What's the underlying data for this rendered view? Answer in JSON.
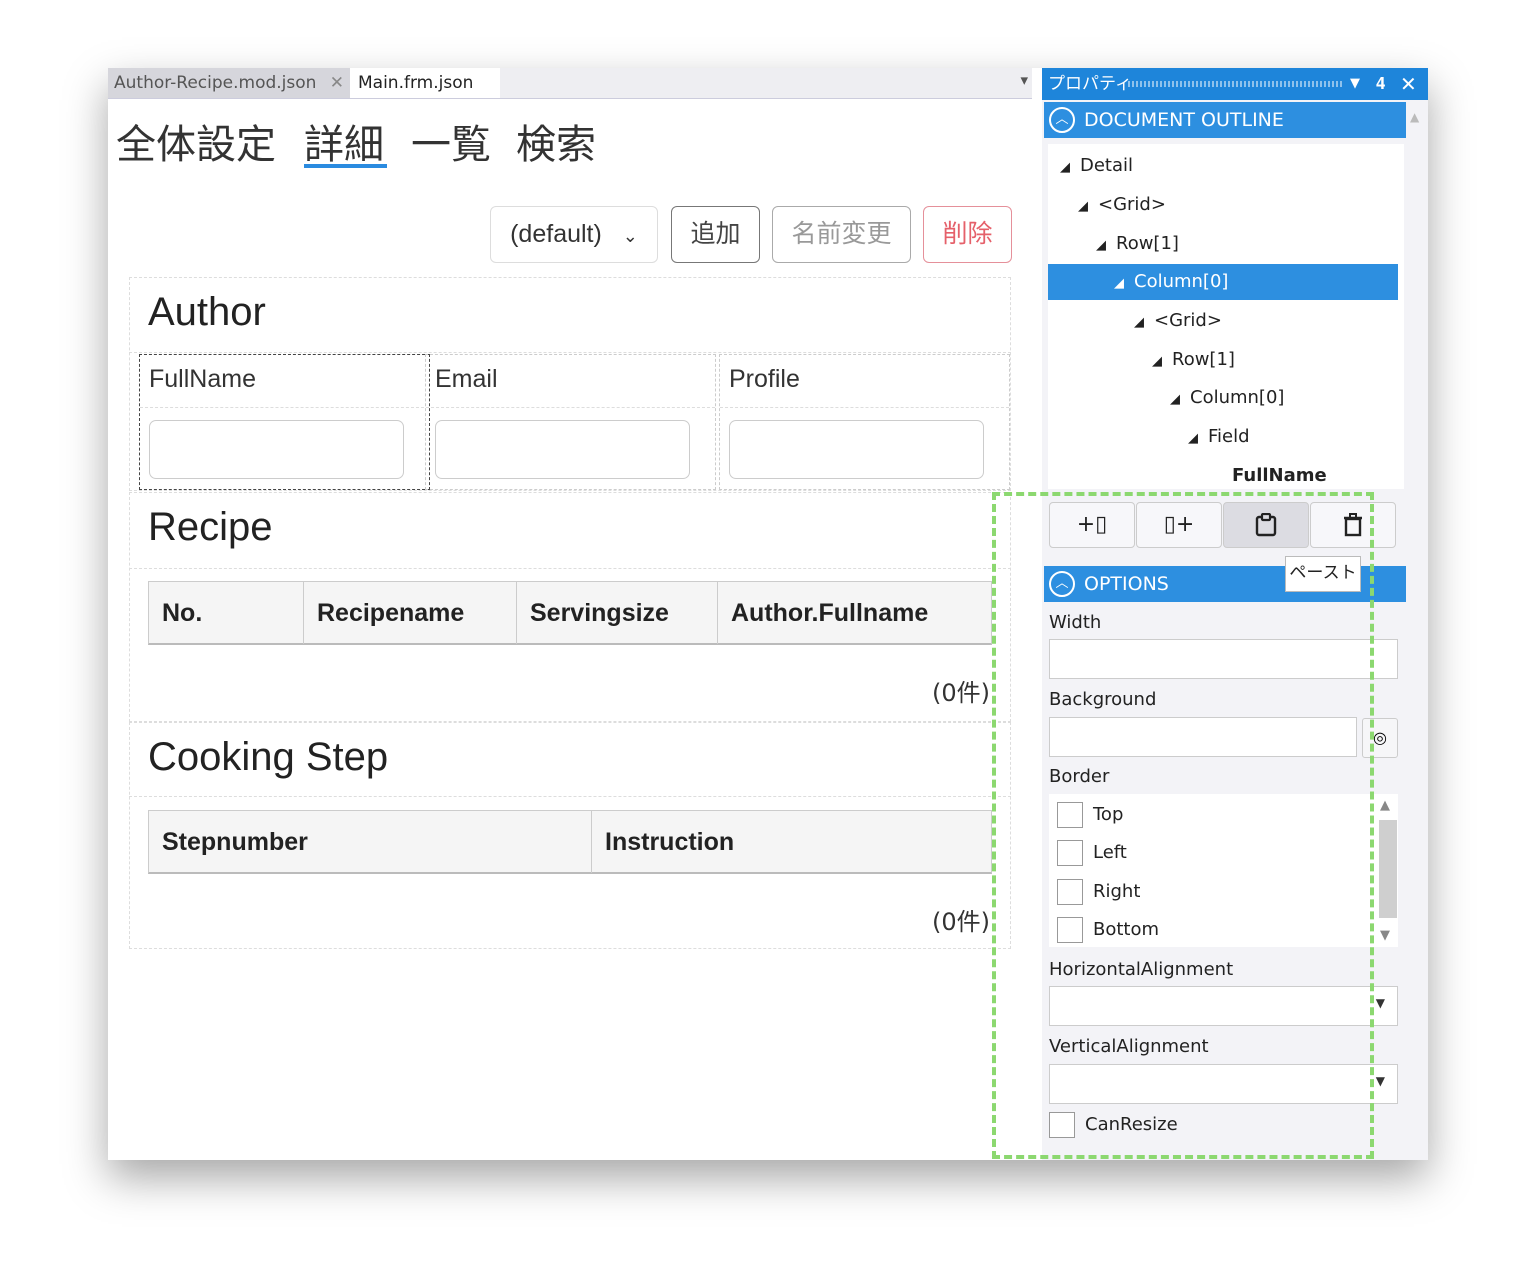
{
  "tabs": [
    {
      "label": "Author-Recipe.mod.json",
      "close": "✕"
    },
    {
      "label": "Main.frm.json"
    }
  ],
  "tab_overflow_icon": "▾",
  "nav": [
    "全体設定",
    "詳細",
    "一覧",
    "検索"
  ],
  "toolbar": {
    "select_value": "(default)",
    "add_label": "追加",
    "rename_label": "名前変更",
    "delete_label": "削除"
  },
  "author_section": {
    "title": "Author",
    "fields": [
      "FullName",
      "Email",
      "Profile"
    ]
  },
  "recipe_section": {
    "title": "Recipe",
    "columns": [
      "No.",
      "Recipename",
      "Servingsize",
      "Author.Fullname"
    ],
    "count": "(0件)"
  },
  "cooking_section": {
    "title": "Cooking Step",
    "columns": [
      "Stepnumber",
      "Instruction"
    ],
    "count": "(0件)"
  },
  "panel": {
    "title": "プロパティ",
    "outline_header": "DOCUMENT OUTLINE",
    "tree": [
      {
        "label": "Detail",
        "arrow": "◢",
        "selected": false
      },
      {
        "label": "<Grid>",
        "arrow": "◢",
        "selected": false
      },
      {
        "label": "Row[1]",
        "arrow": "◢",
        "selected": false
      },
      {
        "label": "Column[0]",
        "arrow": "◢",
        "selected": true
      },
      {
        "label": "<Grid>",
        "arrow": "◢",
        "selected": false
      },
      {
        "label": "Row[1]",
        "arrow": "◢",
        "selected": false
      },
      {
        "label": "Column[0]",
        "arrow": "◢",
        "selected": false
      },
      {
        "label": "Field",
        "arrow": "◢",
        "selected": false
      },
      {
        "label": "FullName",
        "arrow": "",
        "selected": false
      }
    ],
    "tool_buttons": [
      {
        "icon": "insert-column-before-icon"
      },
      {
        "icon": "insert-column-after-icon"
      },
      {
        "icon": "paste-icon"
      },
      {
        "icon": "delete-icon"
      }
    ],
    "tooltip": "ペースト",
    "options_header": "OPTIONS",
    "width_label": "Width",
    "background_label": "Background",
    "border_label": "Border",
    "border_options": [
      "Top",
      "Left",
      "Right",
      "Bottom"
    ],
    "halign_label": "HorizontalAlignment",
    "valign_label": "VerticalAlignment",
    "canresize_label": "CanResize"
  },
  "colors": {
    "accent": "#2d8fe0",
    "highlight_dash": "#8cd870",
    "delete_red": "#e5606a"
  }
}
